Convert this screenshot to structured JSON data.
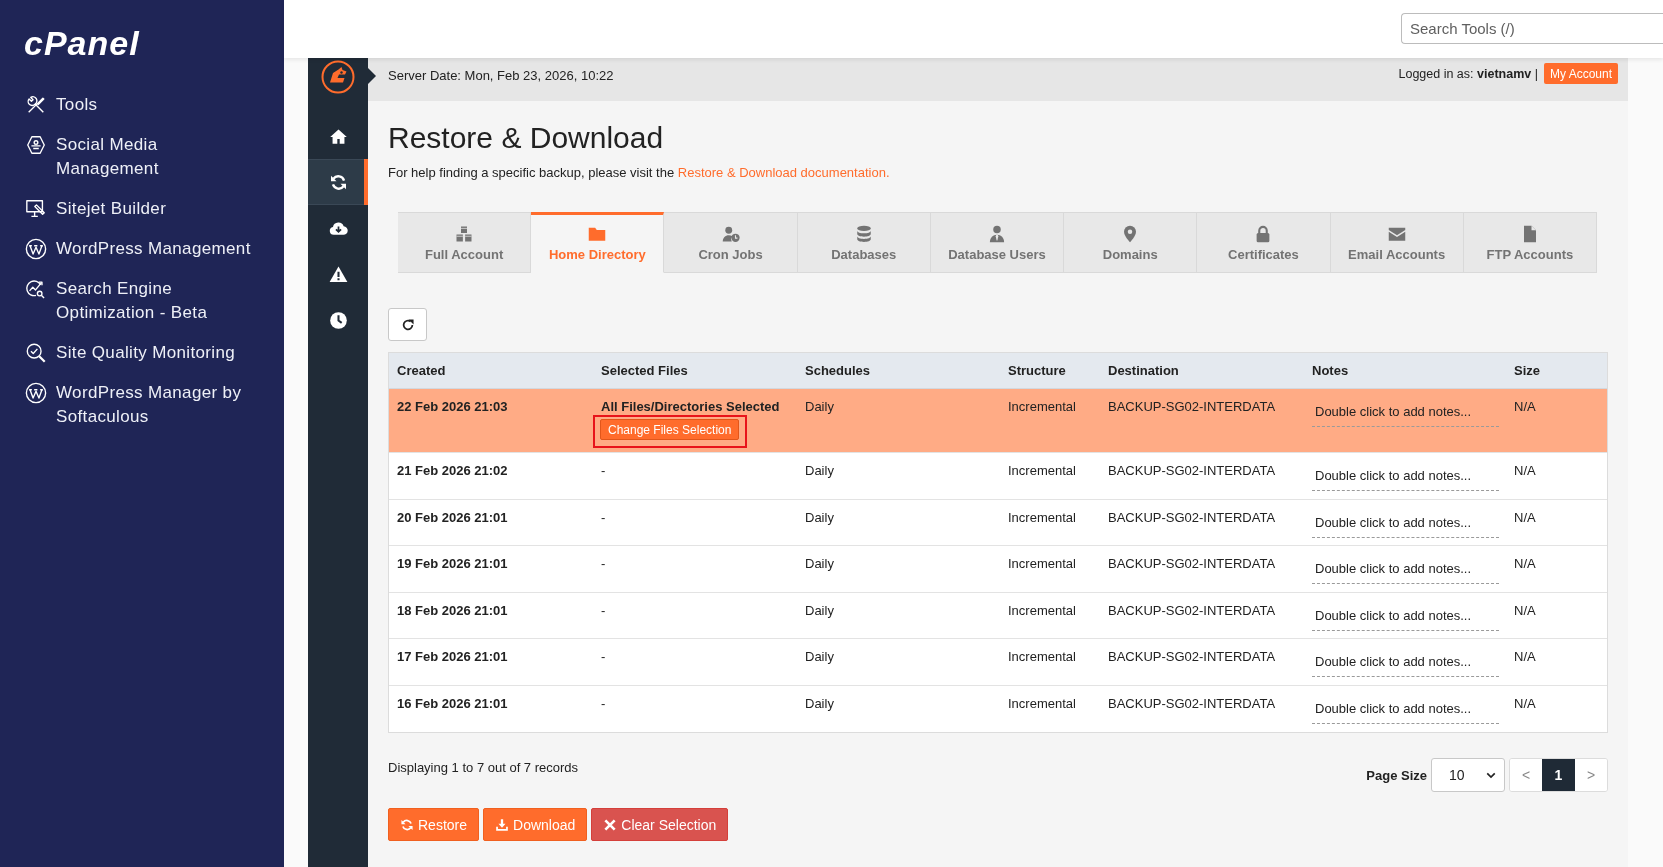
{
  "sidebar": {
    "logo": "cPanel",
    "items": [
      {
        "label": "Tools"
      },
      {
        "label": "Social Media Management"
      },
      {
        "label": "Sitejet Builder"
      },
      {
        "label": "WordPress Management"
      },
      {
        "label": "Search Engine Optimization - Beta"
      },
      {
        "label": "Site Quality Monitoring"
      },
      {
        "label": "WordPress Manager by Softaculous"
      }
    ]
  },
  "search": {
    "placeholder": "Search Tools (/)"
  },
  "rail": {
    "items": [
      {
        "selected": false
      },
      {
        "selected": true
      },
      {
        "selected": false
      },
      {
        "selected": false
      },
      {
        "selected": false
      }
    ]
  },
  "header": {
    "server_date": "Server Date: Mon, Feb 23, 2026, 10:22",
    "logged_in": "Logged in as: **vietnamv** |",
    "account_button": "My Account"
  },
  "page": {
    "title": "Restore & Download",
    "help_text": "For help finding a specific backup, please visit the",
    "help_link": "Restore & Download documentation."
  },
  "tabs": [
    {
      "label": "Full Account",
      "selected": false
    },
    {
      "label": "Home Directory",
      "selected": true
    },
    {
      "label": "Cron Jobs",
      "selected": false
    },
    {
      "label": "Databases",
      "selected": false
    },
    {
      "label": "Database Users",
      "selected": false
    },
    {
      "label": "Domains",
      "selected": false
    },
    {
      "label": "Certificates",
      "selected": false
    },
    {
      "label": "Email Accounts",
      "selected": false
    },
    {
      "label": "FTP Accounts",
      "selected": false
    }
  ],
  "table": {
    "columns": [
      "Created",
      "Selected Files",
      "Schedules",
      "Structure",
      "Destination",
      "Notes",
      "Size"
    ],
    "rows": [
      {
        "created": "22 Feb 2026 21:03",
        "selected_files": "All Files/Directories Selected",
        "change_button": {
          "label": "Change Files Selection",
          "highlighted": true
        },
        "schedules": "Daily",
        "structure": "Incremental",
        "destination": "BACKUP-SG02-INTERDATA",
        "notes": "Double click to add notes...",
        "size": "N/A",
        "selected": true
      },
      {
        "created": "21 Feb 2026 21:02",
        "selected_files": "-",
        "schedules": "Daily",
        "structure": "Incremental",
        "destination": "BACKUP-SG02-INTERDATA",
        "notes": "Double click to add notes...",
        "size": "N/A",
        "selected": false
      },
      {
        "created": "20 Feb 2026 21:01",
        "selected_files": "-",
        "schedules": "Daily",
        "structure": "Incremental",
        "destination": "BACKUP-SG02-INTERDATA",
        "notes": "Double click to add notes...",
        "size": "N/A",
        "selected": false
      },
      {
        "created": "19 Feb 2026 21:01",
        "selected_files": "-",
        "schedules": "Daily",
        "structure": "Incremental",
        "destination": "BACKUP-SG02-INTERDATA",
        "notes": "Double click to add notes...",
        "size": "N/A",
        "selected": false
      },
      {
        "created": "18 Feb 2026 21:01",
        "selected_files": "-",
        "schedules": "Daily",
        "structure": "Incremental",
        "destination": "BACKUP-SG02-INTERDATA",
        "notes": "Double click to add notes...",
        "size": "N/A",
        "selected": false
      },
      {
        "created": "17 Feb 2026 21:01",
        "selected_files": "-",
        "schedules": "Daily",
        "structure": "Incremental",
        "destination": "BACKUP-SG02-INTERDATA",
        "notes": "Double click to add notes...",
        "size": "N/A",
        "selected": false
      },
      {
        "created": "16 Feb 2026 21:01",
        "selected_files": "-",
        "schedules": "Daily",
        "structure": "Incremental",
        "destination": "BACKUP-SG02-INTERDATA",
        "notes": "Double click to add notes...",
        "size": "N/A",
        "selected": false
      }
    ]
  },
  "footer": {
    "records": "Displaying 1 to 7 out of 7 records",
    "page_size": {
      "label": "Page Size",
      "value": "10"
    },
    "pagination": {
      "prev": "<",
      "pages": [
        {
          "label": "1",
          "selected": true
        }
      ],
      "next": ">"
    }
  },
  "actions": [
    {
      "label": "Restore",
      "kind": "primary"
    },
    {
      "label": "Download",
      "kind": "primary"
    },
    {
      "label": "Clear Selection",
      "kind": "danger"
    }
  ]
}
